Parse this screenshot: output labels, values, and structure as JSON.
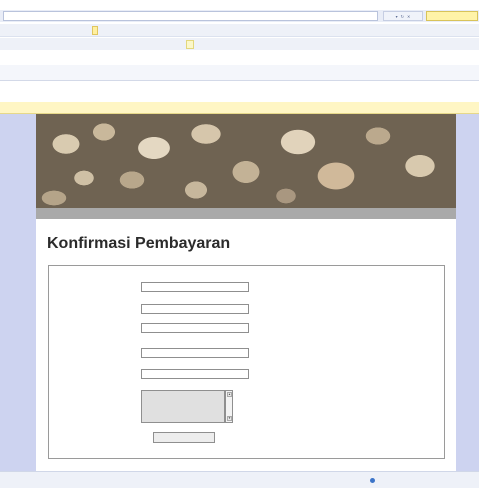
{
  "browser": {
    "address": "",
    "search_placeholder": "",
    "toolbar_buttons": [
      "",
      "",
      "",
      ""
    ],
    "links_buttons": [
      "",
      "",
      ""
    ],
    "page_tab": "",
    "tab_tools": [
      "",
      "",
      "",
      ""
    ],
    "info_bar": ""
  },
  "site": {
    "nav": [
      "",
      "",
      "",
      "",
      "",
      ""
    ]
  },
  "page": {
    "title": "Konfirmasi Pembayaran"
  },
  "form": {
    "fields": [
      {
        "label": "",
        "value": ""
      },
      {
        "label": "",
        "value": ""
      },
      {
        "label": "",
        "value": ""
      },
      {
        "label": "",
        "value": ""
      },
      {
        "label": "",
        "value": ""
      }
    ],
    "notes_label": "",
    "notes_value": "",
    "submit_label": ""
  },
  "status": {
    "zone_text": ""
  },
  "colors": {
    "nav_bar": "#a9a9a9",
    "canvas": "#cdd3f0",
    "search_box": "#fff3a8",
    "info_bar": "#fff6c4"
  }
}
